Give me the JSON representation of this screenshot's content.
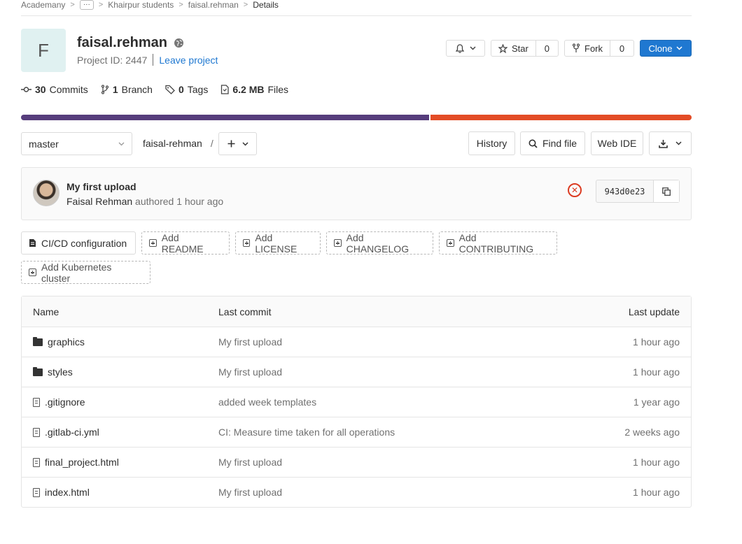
{
  "breadcrumb": {
    "items": [
      "Academany",
      "Khairpur students",
      "faisal.rehman",
      "Details"
    ]
  },
  "project": {
    "avatar_letter": "F",
    "name": "faisal.rehman",
    "id_label": "Project ID: 2447",
    "leave_label": "Leave project"
  },
  "actions": {
    "star_label": "Star",
    "star_count": "0",
    "fork_label": "Fork",
    "fork_count": "0",
    "clone_label": "Clone"
  },
  "stats": {
    "commits_count": "30",
    "commits_label": "Commits",
    "branch_count": "1",
    "branch_label": "Branch",
    "tags_count": "0",
    "tags_label": "Tags",
    "files_size": "6.2 MB",
    "files_label": "Files"
  },
  "language_bar": [
    {
      "color": "#563d7c",
      "fraction": 0.61
    },
    {
      "color": "#e34c26",
      "fraction": 0.39
    }
  ],
  "repo_nav": {
    "branch": "master",
    "path": "faisal-rehman",
    "path_sep": "/",
    "history_label": "History",
    "find_file_label": "Find file",
    "web_ide_label": "Web IDE"
  },
  "last_commit": {
    "title": "My first upload",
    "author": "Faisal Rehman",
    "meta": "authored 1 hour ago",
    "sha": "943d0e23",
    "status_color": "#db3b21"
  },
  "quick_actions": [
    "CI/CD configuration",
    "Add README",
    "Add LICENSE",
    "Add CHANGELOG",
    "Add CONTRIBUTING",
    "Add Kubernetes cluster"
  ],
  "file_tree": {
    "headers": {
      "name": "Name",
      "last_commit": "Last commit",
      "last_update": "Last update"
    },
    "rows": [
      {
        "type": "folder",
        "name": "graphics",
        "commit": "My first upload",
        "updated": "1 hour ago"
      },
      {
        "type": "folder",
        "name": "styles",
        "commit": "My first upload",
        "updated": "1 hour ago"
      },
      {
        "type": "file",
        "name": ".gitignore",
        "commit": "added week templates",
        "updated": "1 year ago"
      },
      {
        "type": "file",
        "name": ".gitlab-ci.yml",
        "commit": "CI: Measure time taken for all operations",
        "updated": "2 weeks ago"
      },
      {
        "type": "file",
        "name": "final_project.html",
        "commit": "My first upload",
        "updated": "1 hour ago"
      },
      {
        "type": "file",
        "name": "index.html",
        "commit": "My first upload",
        "updated": "1 hour ago"
      }
    ]
  }
}
